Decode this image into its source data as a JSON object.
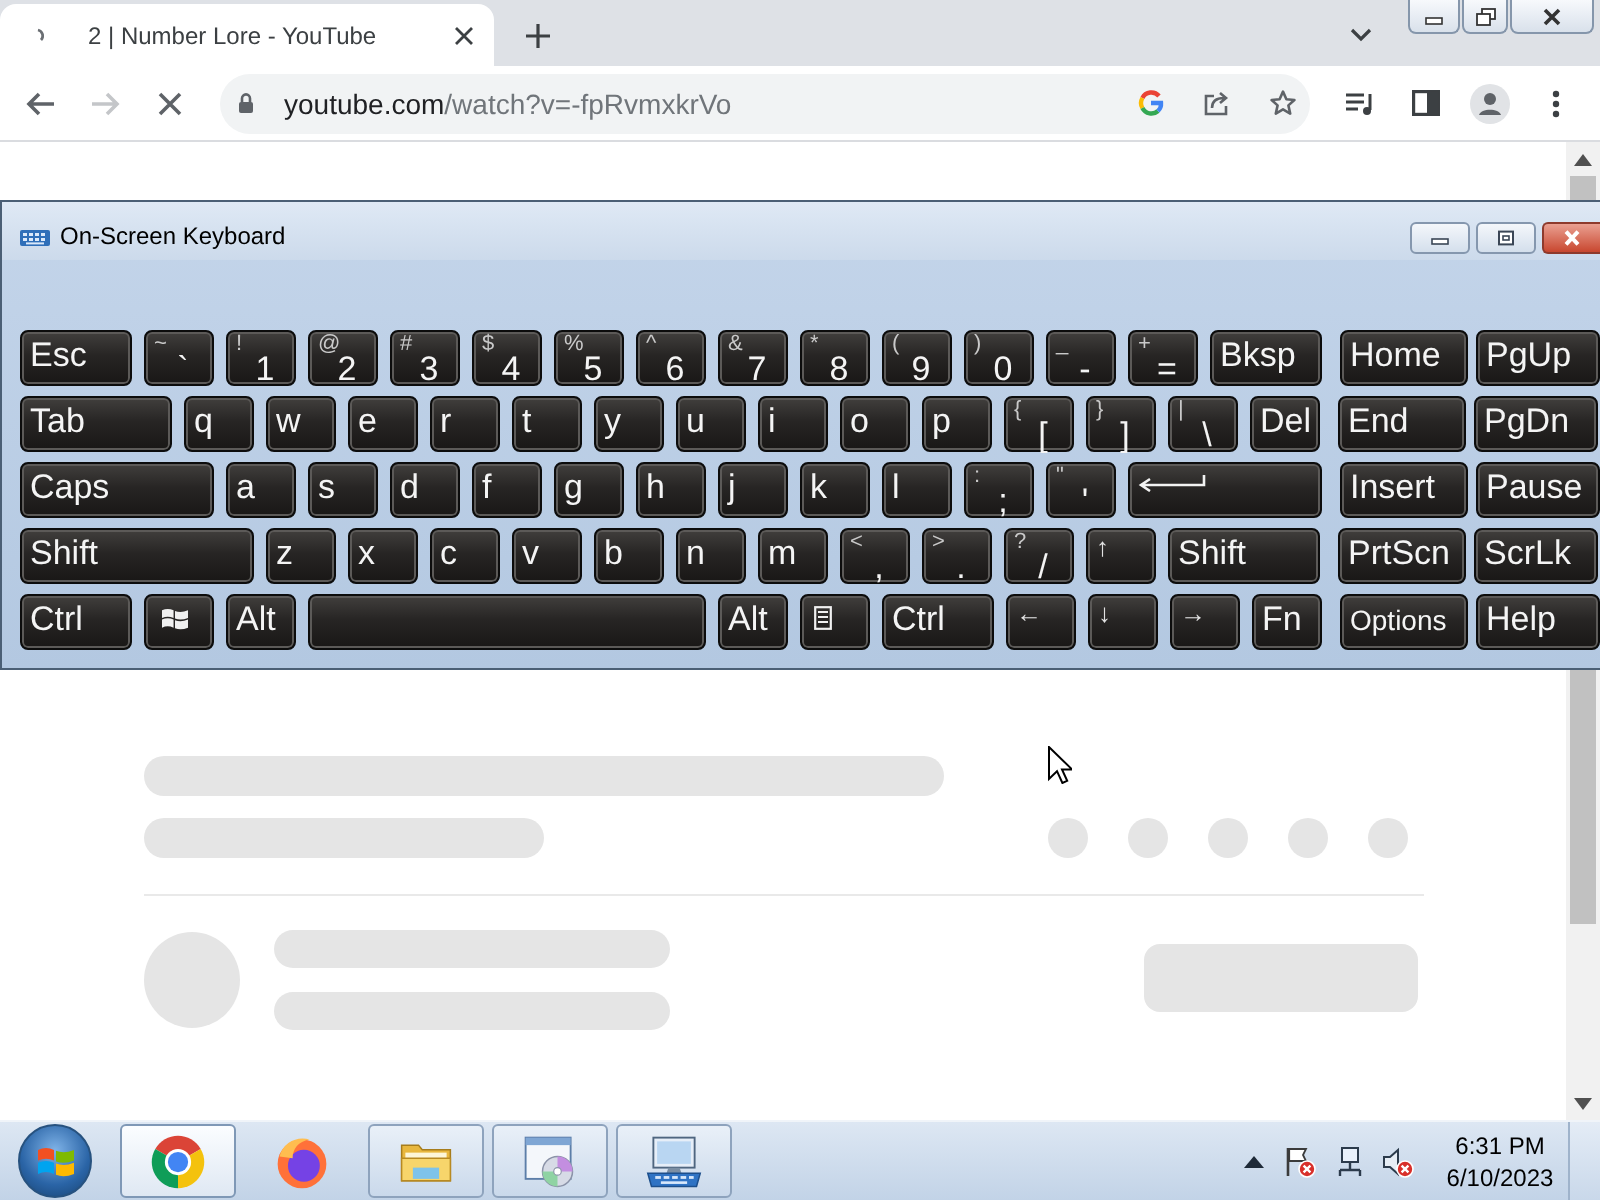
{
  "browser": {
    "tabs": [
      {
        "title": "2 | Number Lore - YouTube",
        "selected": true
      }
    ],
    "nav_buttons": [
      {
        "kind": "back",
        "disabled": false
      },
      {
        "kind": "forward",
        "disabled": true
      },
      {
        "kind": "stop",
        "disabled": false
      }
    ],
    "address_bar": {
      "host": "youtube.com",
      "path": "/watch?v=-fpRvmxkrVo"
    }
  },
  "keyboard_window": {
    "title": "On-Screen Keyboard",
    "rows": [
      {
        "main": [
          {
            "kind": "text",
            "label": "Esc"
          },
          {
            "kind": "dual",
            "shift": "~",
            "label": "`"
          },
          {
            "kind": "dual",
            "shift": "!",
            "label": "1"
          },
          {
            "kind": "dual",
            "shift": "@",
            "label": "2"
          },
          {
            "kind": "dual",
            "shift": "#",
            "label": "3"
          },
          {
            "kind": "dual",
            "shift": "$",
            "label": "4"
          },
          {
            "kind": "dual",
            "shift": "%",
            "label": "5"
          },
          {
            "kind": "dual",
            "shift": "^",
            "label": "6"
          },
          {
            "kind": "dual",
            "shift": "&",
            "label": "7"
          },
          {
            "kind": "dual",
            "shift": "*",
            "label": "8"
          },
          {
            "kind": "dual",
            "shift": "(",
            "label": "9"
          },
          {
            "kind": "dual",
            "shift": ")",
            "label": "0"
          },
          {
            "kind": "dual",
            "shift": "_",
            "label": "-"
          },
          {
            "kind": "dual",
            "shift": "+",
            "label": "="
          },
          {
            "kind": "text",
            "label": "Bksp"
          }
        ],
        "side": [
          {
            "kind": "text",
            "label": "Home"
          },
          {
            "kind": "text",
            "label": "PgUp"
          }
        ]
      },
      {
        "main": [
          {
            "kind": "text",
            "label": "Tab"
          },
          {
            "kind": "text",
            "label": "q"
          },
          {
            "kind": "text",
            "label": "w"
          },
          {
            "kind": "text",
            "label": "e"
          },
          {
            "kind": "text",
            "label": "r"
          },
          {
            "kind": "text",
            "label": "t"
          },
          {
            "kind": "text",
            "label": "y"
          },
          {
            "kind": "text",
            "label": "u"
          },
          {
            "kind": "text",
            "label": "i"
          },
          {
            "kind": "text",
            "label": "o"
          },
          {
            "kind": "text",
            "label": "p"
          },
          {
            "kind": "dual",
            "shift": "{",
            "label": "["
          },
          {
            "kind": "dual",
            "shift": "}",
            "label": "]"
          },
          {
            "kind": "dual",
            "shift": "|",
            "label": "\\"
          },
          {
            "kind": "text",
            "label": "Del"
          }
        ],
        "side": [
          {
            "kind": "text",
            "label": "End"
          },
          {
            "kind": "text",
            "label": "PgDn"
          }
        ]
      },
      {
        "main": [
          {
            "kind": "text",
            "label": "Caps"
          },
          {
            "kind": "text",
            "label": "a"
          },
          {
            "kind": "text",
            "label": "s"
          },
          {
            "kind": "text",
            "label": "d"
          },
          {
            "kind": "text",
            "label": "f"
          },
          {
            "kind": "text",
            "label": "g"
          },
          {
            "kind": "text",
            "label": "h"
          },
          {
            "kind": "text",
            "label": "j"
          },
          {
            "kind": "text",
            "label": "k"
          },
          {
            "kind": "text",
            "label": "l"
          },
          {
            "kind": "dual",
            "shift": ":",
            "label": ";"
          },
          {
            "kind": "dual",
            "shift": "\"",
            "label": "'"
          },
          {
            "kind": "enter"
          }
        ],
        "side": [
          {
            "kind": "text",
            "label": "Insert"
          },
          {
            "kind": "text",
            "label": "Pause"
          }
        ]
      },
      {
        "main": [
          {
            "kind": "text",
            "label": "Shift"
          },
          {
            "kind": "text",
            "label": "z"
          },
          {
            "kind": "text",
            "label": "x"
          },
          {
            "kind": "text",
            "label": "c"
          },
          {
            "kind": "text",
            "label": "v"
          },
          {
            "kind": "text",
            "label": "b"
          },
          {
            "kind": "text",
            "label": "n"
          },
          {
            "kind": "text",
            "label": "m"
          },
          {
            "kind": "dual",
            "shift": "<",
            "label": ","
          },
          {
            "kind": "dual",
            "shift": ">",
            "label": "."
          },
          {
            "kind": "dual",
            "shift": "?",
            "label": "/"
          },
          {
            "kind": "arrow",
            "label": "↑"
          },
          {
            "kind": "text",
            "label": "Shift"
          }
        ],
        "side": [
          {
            "kind": "text",
            "label": "PrtScn"
          },
          {
            "kind": "text",
            "label": "ScrLk"
          }
        ]
      },
      {
        "main": [
          {
            "kind": "text",
            "label": "Ctrl"
          },
          {
            "kind": "windows"
          },
          {
            "kind": "text",
            "label": "Alt"
          },
          {
            "kind": "space"
          },
          {
            "kind": "text",
            "label": "Alt"
          },
          {
            "kind": "menu"
          },
          {
            "kind": "text",
            "label": "Ctrl"
          },
          {
            "kind": "arrow",
            "label": "←"
          },
          {
            "kind": "arrow",
            "label": "↓"
          },
          {
            "kind": "arrow",
            "label": "→"
          },
          {
            "kind": "text",
            "label": "Fn"
          }
        ],
        "side": [
          {
            "kind": "small",
            "label": "Options"
          },
          {
            "kind": "text",
            "label": "Help"
          }
        ]
      }
    ]
  },
  "taskbar": {
    "apps": [
      {
        "kind": "ring",
        "selected": true,
        "running": true
      },
      {
        "kind": "fox",
        "selected": false,
        "running": false
      },
      {
        "kind": "folder",
        "selected": false,
        "running": true
      },
      {
        "kind": "disc",
        "selected": false,
        "running": true
      },
      {
        "kind": "keyboard",
        "selected": false,
        "running": true
      }
    ],
    "tray": [
      {
        "kind": "caret",
        "badge": false
      },
      {
        "kind": "flag",
        "badge": true
      },
      {
        "kind": "network",
        "badge": false
      },
      {
        "kind": "speaker",
        "badge": true
      }
    ],
    "clock": {
      "time": "6:31 PM",
      "date": "6/10/2023"
    }
  }
}
